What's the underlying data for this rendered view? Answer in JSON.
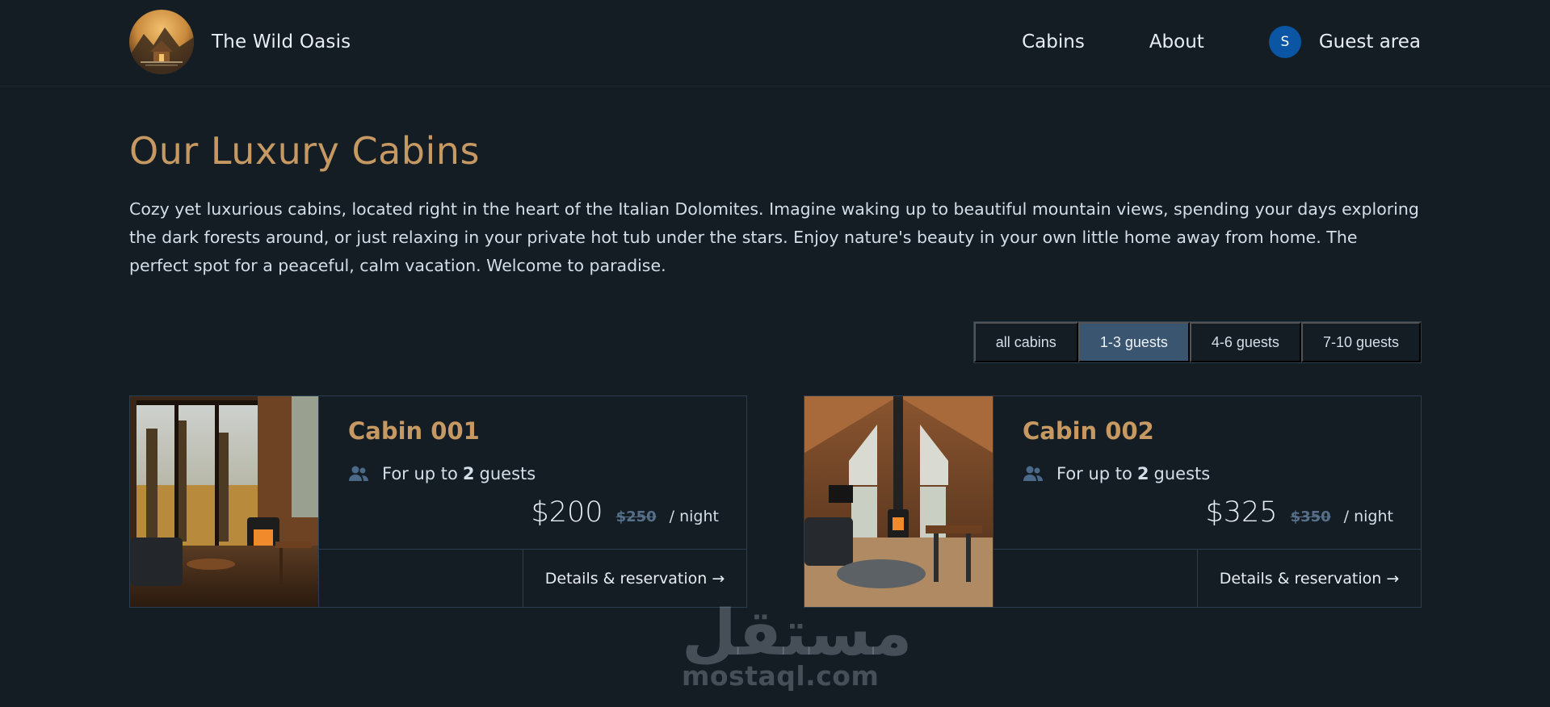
{
  "header": {
    "brand": "The Wild Oasis",
    "nav": {
      "cabins": "Cabins",
      "about": "About",
      "guest_area": "Guest area",
      "avatar_initial": "S"
    }
  },
  "main": {
    "title": "Our Luxury Cabins",
    "intro": "Cozy yet luxurious cabins, located right in the heart of the Italian Dolomites. Imagine waking up to beautiful mountain views, spending your days exploring the dark forests around, or just relaxing in your private hot tub under the stars. Enjoy nature's beauty in your own little home away from home. The perfect spot for a peaceful, calm vacation. Welcome to paradise."
  },
  "filter": {
    "options": [
      "all cabins",
      "1-3 guests",
      "4-6 guests",
      "7-10 guests"
    ],
    "active": "1-3 guests"
  },
  "cabins": [
    {
      "name": "Cabin 001",
      "guests_prefix": "For up to",
      "max_guests": "2",
      "guests_suffix": "guests",
      "price": "$200",
      "old_price": "$250",
      "per": "/ night",
      "cta": "Details & reservation →"
    },
    {
      "name": "Cabin 002",
      "guests_prefix": "For up to",
      "max_guests": "2",
      "guests_suffix": "guests",
      "price": "$325",
      "old_price": "$350",
      "per": "/ night",
      "cta": "Details & reservation →"
    }
  ],
  "watermark": {
    "arabic": "مستقل",
    "latin": "mostaql.com"
  },
  "colors": {
    "background": "#141c24",
    "accent": "#c69963",
    "active_filter": "#3a5570",
    "avatar": "#0a56a4",
    "border": "#2c3d4f"
  },
  "icons": {
    "guests": "users-icon",
    "logo": "cabin-logo"
  }
}
